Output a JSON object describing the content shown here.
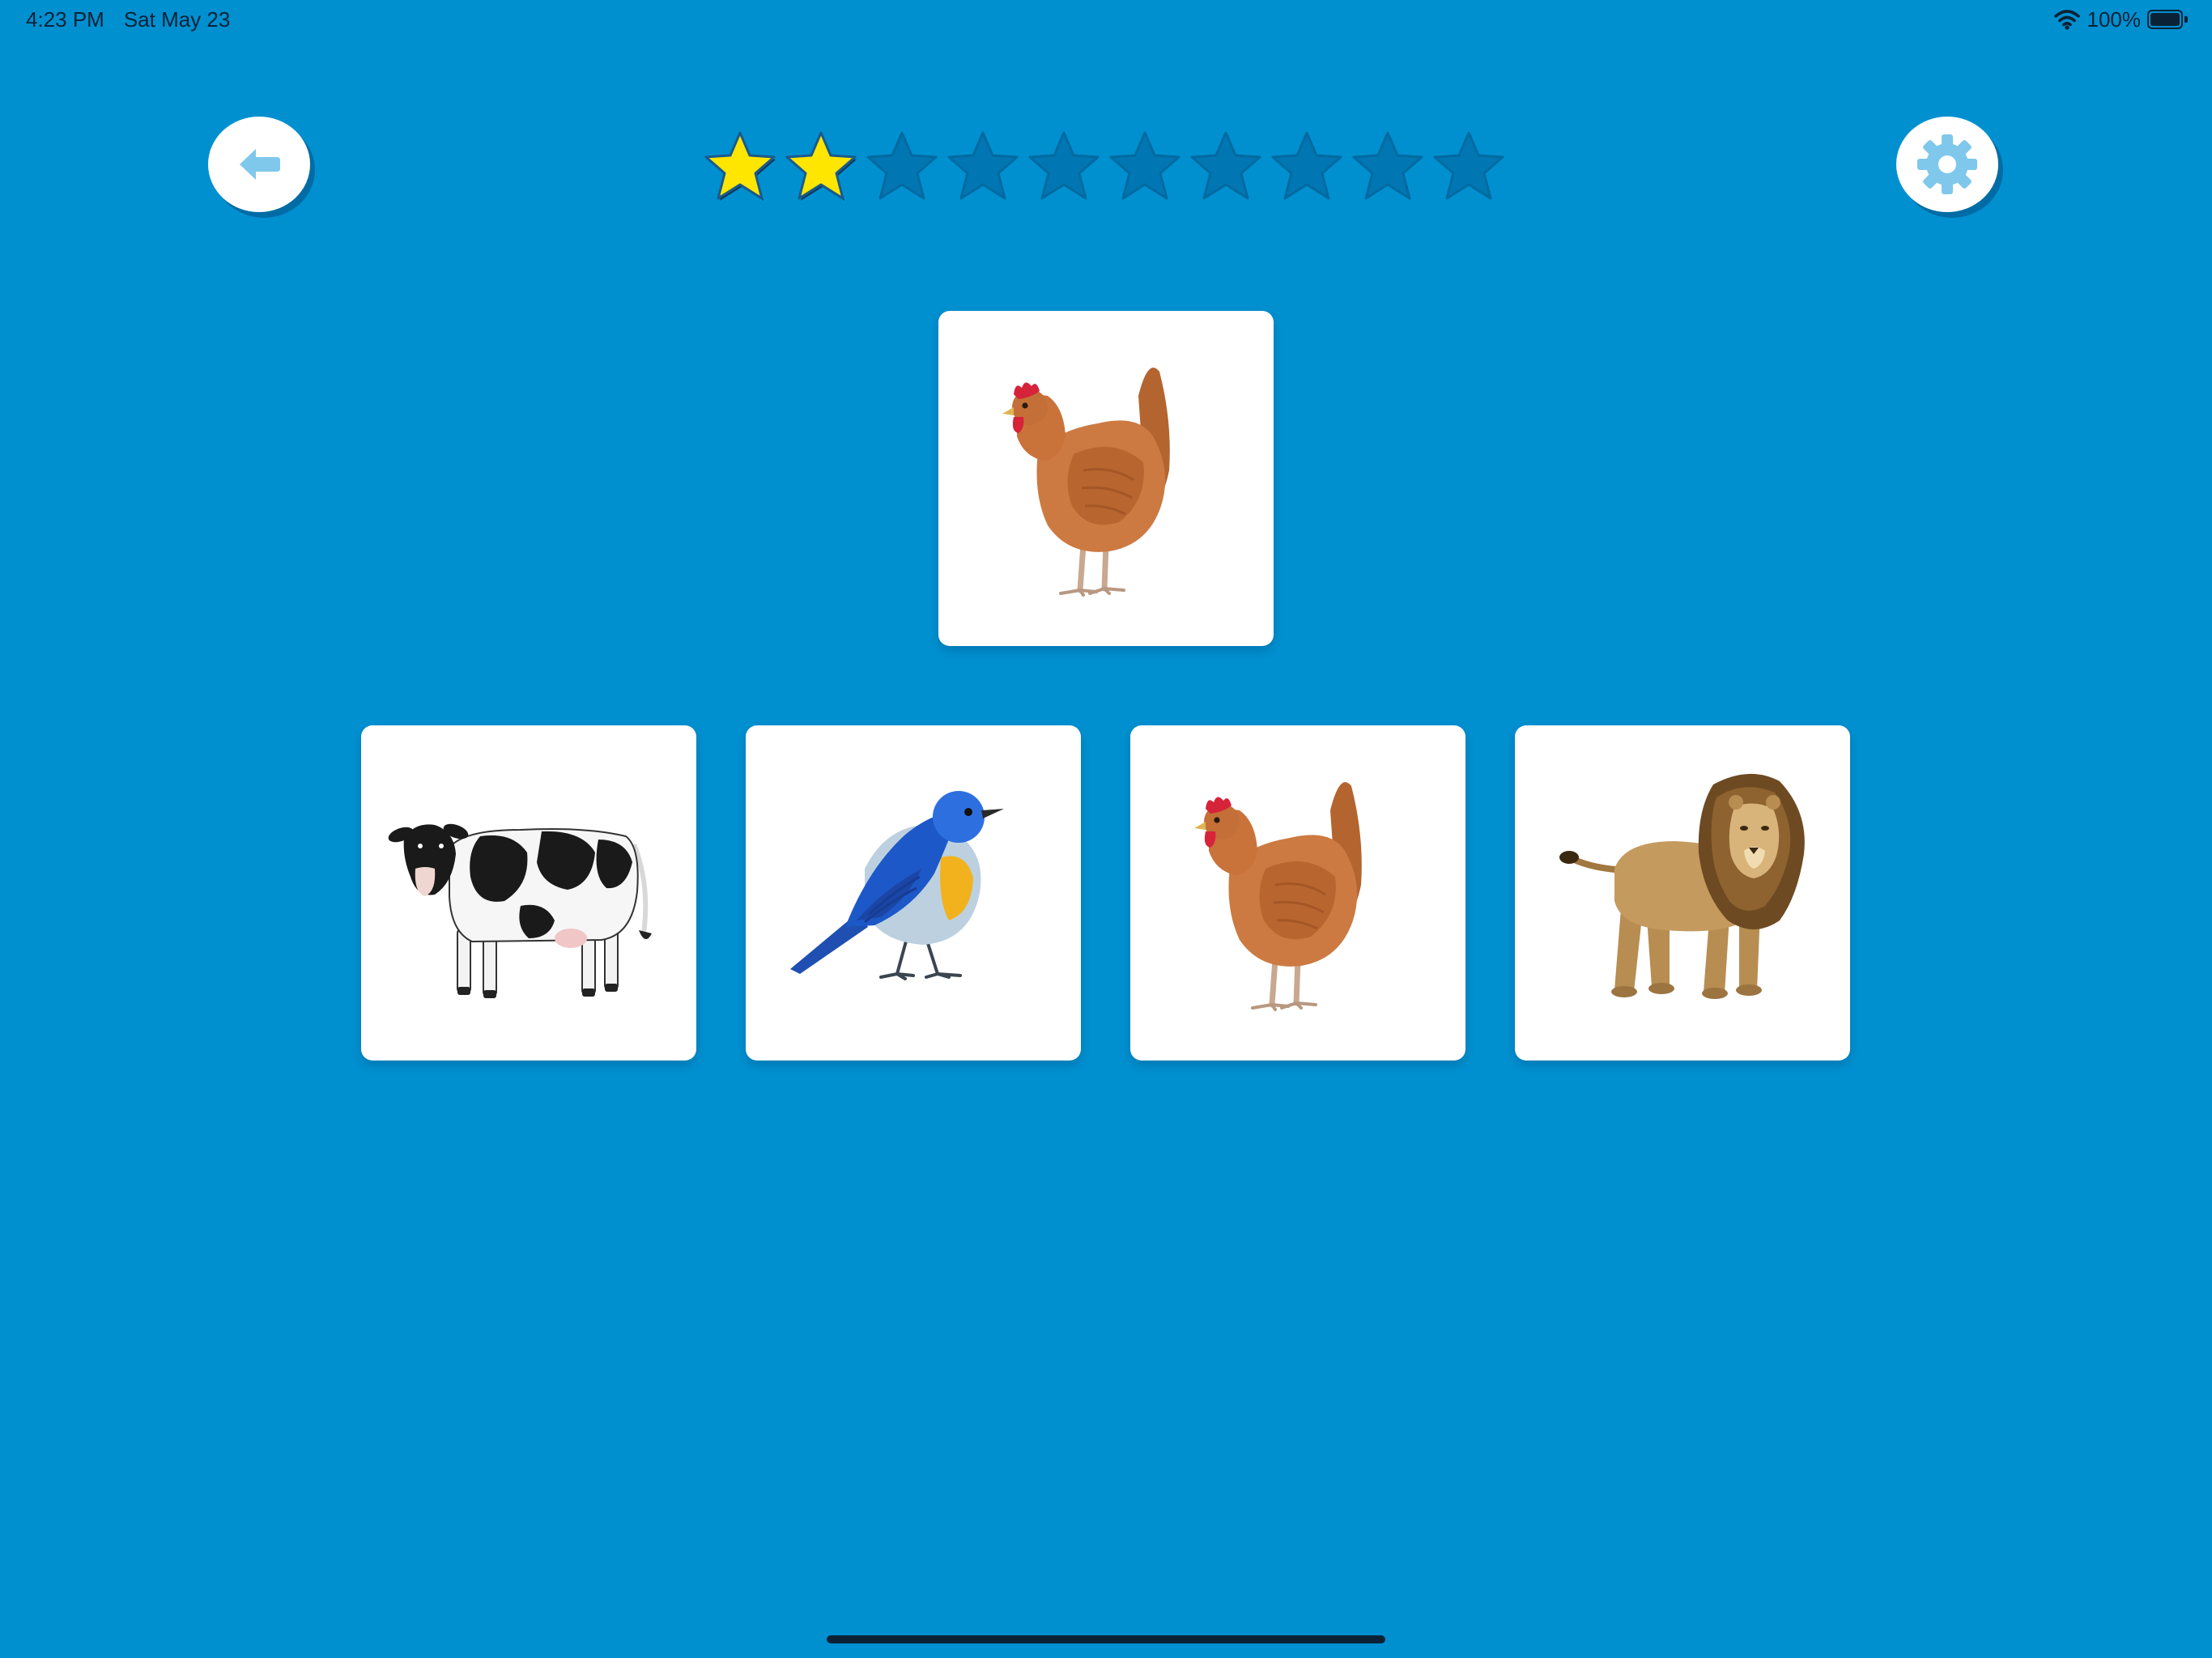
{
  "theme": {
    "background": "#0090D0",
    "star_filled": "#FFE600",
    "star_empty": "#0077B3",
    "icon_color": "#7FC8EB"
  },
  "status_bar": {
    "time": "4:23 PM",
    "date": "Sat May 23",
    "battery_text": "100%",
    "battery_level": 1.0,
    "icons": [
      "wifi-icon",
      "battery-icon"
    ]
  },
  "toolbar": {
    "back_icon": "arrow-left-icon",
    "settings_icon": "gear-icon"
  },
  "progress": {
    "stars_earned": 2,
    "stars_total": 10
  },
  "game": {
    "target": {
      "animal": "chicken"
    },
    "choices": [
      {
        "animal": "cow"
      },
      {
        "animal": "bird"
      },
      {
        "animal": "chicken"
      },
      {
        "animal": "lion"
      }
    ]
  }
}
